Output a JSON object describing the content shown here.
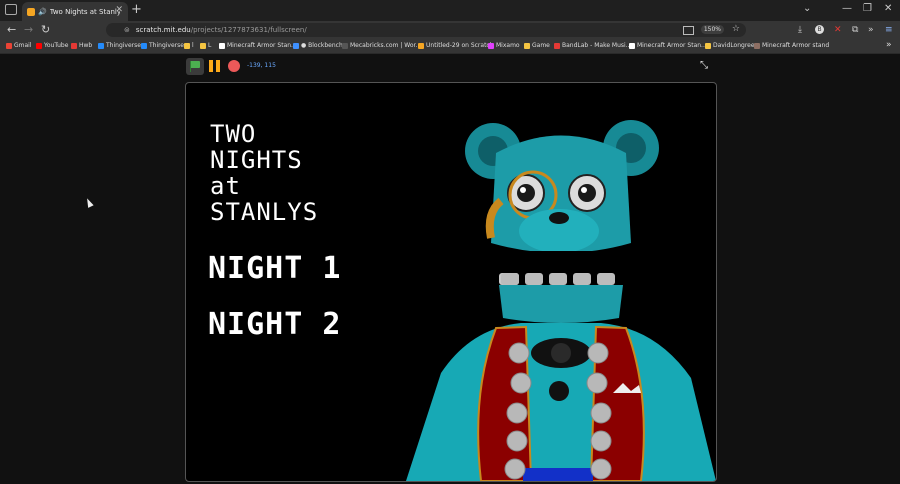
{
  "browser": {
    "tab_title": "Two Nights at Stanlys on Scratch",
    "tab_close": "✕",
    "new_tab": "+",
    "url_host": "scratch.mit.edu",
    "url_path": "/projects/1277873631/fullscreen/",
    "zoom": "150%",
    "window_controls": [
      "⌄",
      "—",
      "❐",
      "✕"
    ],
    "bookmarks": [
      {
        "label": "Gmail",
        "color": "#ea4335"
      },
      {
        "label": "YouTube",
        "color": "#ff0000"
      },
      {
        "label": "Hwb",
        "color": "#e53935"
      },
      {
        "label": "Thingiverse",
        "color": "#248bfb"
      },
      {
        "label": "Thingiverse",
        "color": "#248bfb"
      },
      {
        "label": "l",
        "color": "#f5c542"
      },
      {
        "label": "L",
        "color": "#f5c542"
      },
      {
        "label": "Minecraft Armor Stan...",
        "color": "#ffffff"
      },
      {
        "label": "● Blockbench",
        "color": "#3e90ff"
      },
      {
        "label": "Mecabricks.com | Wor...",
        "color": "#222222"
      },
      {
        "label": "Untitled-29 on Scratch",
        "color": "#f5a623"
      },
      {
        "label": "Mixamo",
        "color": "#e040fb"
      },
      {
        "label": "Game",
        "color": "#f5c542"
      },
      {
        "label": "BandLab - Make Musi...",
        "color": "#e53935"
      },
      {
        "label": "Minecraft Armor Stan...",
        "color": "#ffffff"
      },
      {
        "label": "DavidLongree",
        "color": "#f5c542"
      },
      {
        "label": "Minecraft Armor stand",
        "color": "#8d6e63"
      }
    ]
  },
  "player": {
    "coords": "-139, 115"
  },
  "stage": {
    "title_lines": [
      "TWO",
      "NIGHTS",
      "at",
      "STANLYS"
    ],
    "night1": "NIGHT 1",
    "night2": "NIGHT 2"
  }
}
